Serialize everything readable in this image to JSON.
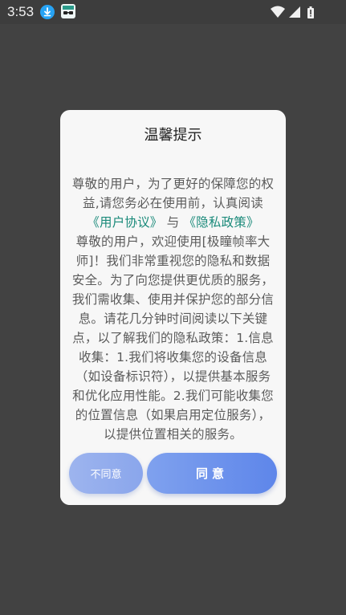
{
  "status_bar": {
    "time": "3:53",
    "icons": [
      "download-icon",
      "app-notification-icon",
      "wifi-icon",
      "signal-icon",
      "battery-icon"
    ]
  },
  "dialog": {
    "title": "温馨提示",
    "intro": "尊敬的用户，为了更好的保障您的权益,请您务必在使用前，认真阅读",
    "user_agreement_link": "《用户协议》",
    "connector": "与",
    "privacy_policy_link": "《隐私政策》",
    "content": "尊敬的用户，欢迎使用[极瞳帧率大师]！我们非常重视您的隐私和数据安全。为了向您提供更优质的服务，我们需收集、使用并保护您的部分信息。请花几分钟时间阅读以下关键点，以了解我们的隐私政策：1.信息收集：1.我们将收集您的设备信息（如设备标识符），以提供基本服务和优化应用性能。2.我们可能收集您的位置信息（如果启用定位服务），以提供位置相关的服务。",
    "disagree_label": "不同意",
    "agree_label": "同意"
  },
  "colors": {
    "backdrop": "#424242",
    "dialog_bg": "#f7f7f7",
    "link": "#1a8a7a",
    "button_primary": "#5e86ea",
    "button_secondary": "#9db4ee"
  }
}
